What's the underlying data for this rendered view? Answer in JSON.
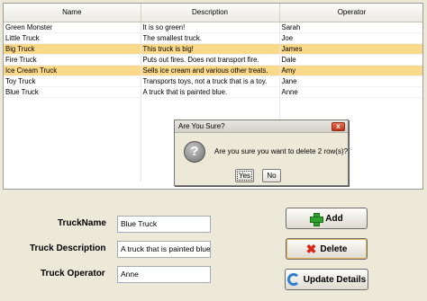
{
  "table": {
    "columns": [
      "Name",
      "Description",
      "Operator"
    ],
    "rows": [
      {
        "name": "Green Monster",
        "description": "It is so green!",
        "operator": "Sarah",
        "selected": false
      },
      {
        "name": "Little Truck",
        "description": "The smallest truck.",
        "operator": "Joe",
        "selected": false
      },
      {
        "name": "Big Truck",
        "description": "This truck is big!",
        "operator": "James",
        "selected": true
      },
      {
        "name": "Fire Truck",
        "description": "Puts out fires. Does not transport fire.",
        "operator": "Dale",
        "selected": false
      },
      {
        "name": "Ice Cream Truck",
        "description": "Sells ice cream and various other treats.",
        "operator": "Amy",
        "selected": true
      },
      {
        "name": "Toy Truck",
        "description": "Transports toys, not a truck that is a toy.",
        "operator": "Jane",
        "selected": false
      },
      {
        "name": "Blue Truck",
        "description": "A truck that is painted blue.",
        "operator": "Anne",
        "selected": false
      }
    ]
  },
  "dialog": {
    "title": "Are You Sure?",
    "close_label": "x",
    "message": "Are you sure you want to delete 2 row(s)?",
    "icon": "question-icon",
    "icon_glyph": "?",
    "yes_label": "Yes",
    "no_label": "No"
  },
  "form": {
    "name_label": "TruckName",
    "name_value": "Blue Truck",
    "description_label": "Truck Description",
    "description_value": "A truck that is painted blue",
    "operator_label": "Truck Operator",
    "operator_value": "Anne"
  },
  "buttons": {
    "add_label": "Add",
    "delete_label": "Delete",
    "update_label": "Update Details"
  },
  "colors": {
    "selected_row": "#fbd98a",
    "window_bg": "#ece9d8"
  }
}
